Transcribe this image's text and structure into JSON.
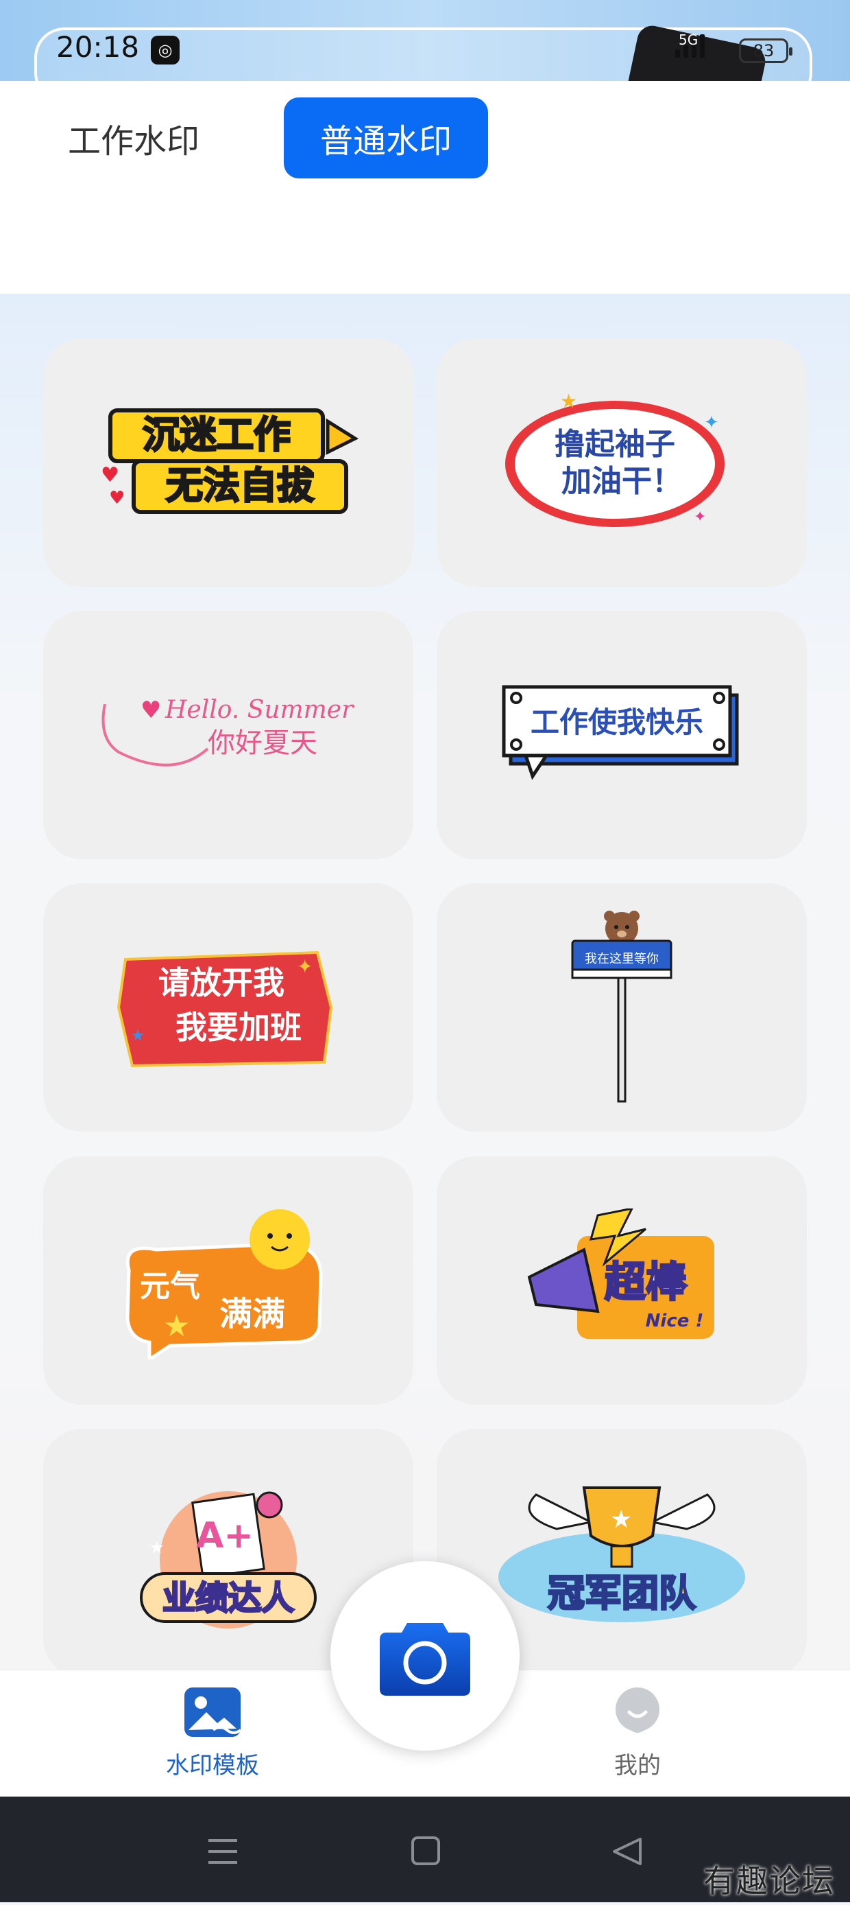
{
  "status_bar": {
    "time": "20:18",
    "network": "5G",
    "battery": "83"
  },
  "tabs": [
    {
      "label": "工作水印",
      "active": false
    },
    {
      "label": "普通水印",
      "active": true
    }
  ],
  "stickers": [
    {
      "line1": "沉迷工作",
      "line2": "无法自拔"
    },
    {
      "line1": "撸起袖子",
      "line2": "加油干！"
    },
    {
      "line1": "Hello. Summer",
      "line2": "你好夏天"
    },
    {
      "line1": "工作使我快乐"
    },
    {
      "line1": "请放开我",
      "line2": "我要加班"
    },
    {
      "line1": "我在这里等你"
    },
    {
      "line1": "元气",
      "line2": "满满"
    },
    {
      "line1": "超棒",
      "line2": "Nice !"
    },
    {
      "line1": "A+",
      "line2": "业绩达人"
    },
    {
      "line1": "冠军团队"
    }
  ],
  "bottom_nav": {
    "templates_label": "水印模板",
    "mine_label": "我的"
  },
  "watermark": "有趣论坛",
  "colors": {
    "accent": "#0a6cf5",
    "nav_active": "#1e63c7"
  }
}
